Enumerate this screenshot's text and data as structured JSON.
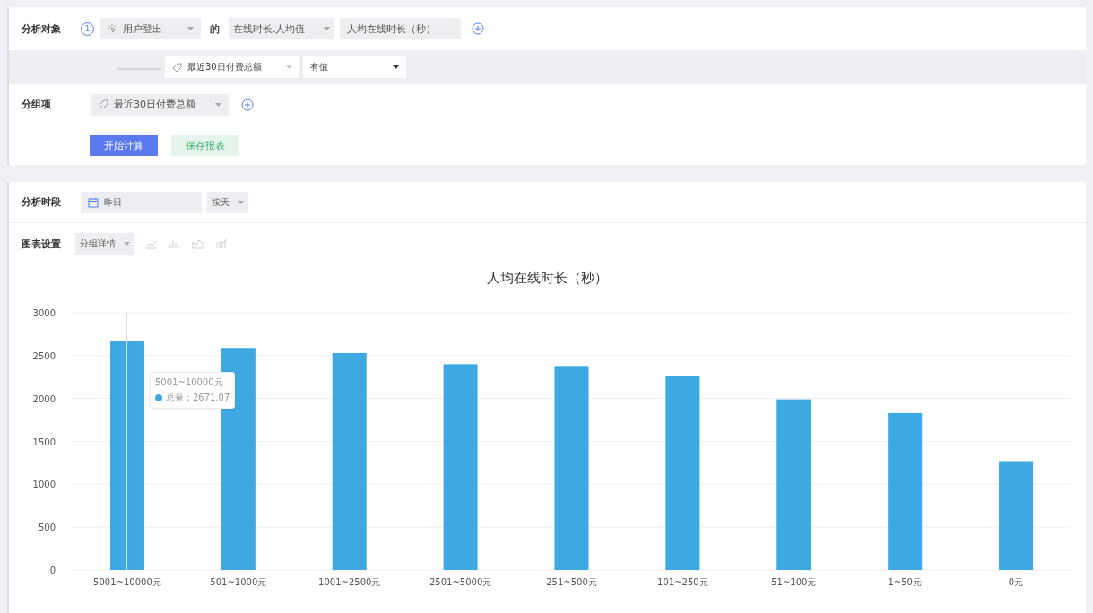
{
  "analysis_target": {
    "label": "分析对象",
    "step": "1",
    "event": "用户登出",
    "connector": "的",
    "metric": "在线时长.人均值",
    "metric_name": "人均在线时长（秒）",
    "filter": {
      "property": "最近30日付费总额",
      "condition": "有值"
    }
  },
  "group_by": {
    "label": "分组项",
    "property": "最近30日付费总额"
  },
  "actions": {
    "calculate": "开始计算",
    "save": "保存报表"
  },
  "period": {
    "label": "分析时段",
    "date": "昨日",
    "granularity": "按天"
  },
  "chart_settings": {
    "label": "图表设置",
    "mode": "分组详情"
  },
  "chart_data": {
    "type": "bar",
    "title": "人均在线时长（秒）",
    "categories": [
      "5001~10000元",
      "501~1000元",
      "1001~2500元",
      "2501~5000元",
      "251~500元",
      "101~250元",
      "51~100元",
      "1~50元",
      "0元"
    ],
    "series": [
      {
        "name": "总量",
        "color": "#3ea8e2",
        "values": [
          2670,
          2590,
          2530,
          2400,
          2380,
          2260,
          1990,
          1830,
          1270
        ]
      }
    ],
    "ylim": [
      0,
      3000
    ],
    "yticks": [
      0,
      500,
      1000,
      1500,
      2000,
      2500,
      3000
    ],
    "grid": true
  },
  "bar_hover": [
    {
      "selected": true
    },
    {
      "selected": false
    },
    {
      "selected": false
    },
    {
      "selected": false
    },
    {
      "selected": false
    },
    {
      "selected": false
    },
    {
      "selected": false
    },
    {
      "selected": false
    },
    {
      "selected": false
    }
  ],
  "tooltip": {
    "title": "5001~10000元",
    "separator": "：",
    "value": "2671.07"
  }
}
